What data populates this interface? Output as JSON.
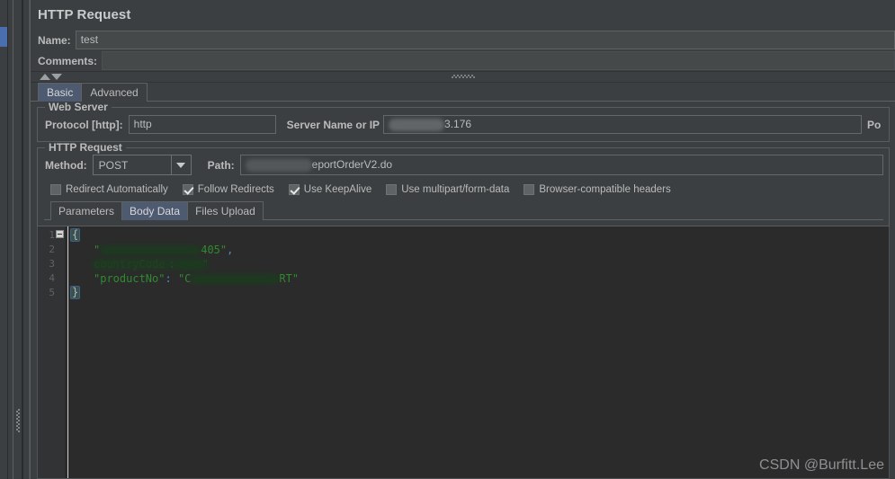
{
  "panel": {
    "title": "HTTP Request",
    "name_label": "Name:",
    "name_value": "test",
    "comments_label": "Comments:",
    "comments_value": ""
  },
  "tabs": [
    {
      "label": "Basic",
      "selected": true
    },
    {
      "label": "Advanced",
      "selected": false
    }
  ],
  "web_server": {
    "group_title": "Web Server",
    "protocol_label": "Protocol [http]:",
    "protocol_value": "http",
    "server_label": "Server Name or IP",
    "server_value": "3.176",
    "port_label": "Po"
  },
  "http_request": {
    "group_title": "HTTP Request",
    "method_label": "Method:",
    "method_value": "POST",
    "path_label": "Path:",
    "path_value": "eportOrderV2.do"
  },
  "options": [
    {
      "label": "Redirect Automatically",
      "checked": false
    },
    {
      "label": "Follow Redirects",
      "checked": true
    },
    {
      "label": "Use KeepAlive",
      "checked": true
    },
    {
      "label": "Use multipart/form-data",
      "checked": false
    },
    {
      "label": "Browser-compatible headers",
      "checked": false
    }
  ],
  "body_tabs": [
    {
      "label": "Parameters",
      "selected": false
    },
    {
      "label": "Body Data",
      "selected": true
    },
    {
      "label": "Files Upload",
      "selected": false
    }
  ],
  "editor": {
    "line_numbers": [
      "1",
      "2",
      "3",
      "4",
      "5"
    ],
    "lines": [
      {
        "open_brace": "{"
      },
      {
        "quote_open": "\"",
        "visible_tail": "405\"",
        "comma": ","
      },
      {
        "quote_open": "\"",
        "key_hint": "countryCode",
        "colon": ":",
        "quote_close": "\""
      },
      {
        "key": "\"productNo\"",
        "colon": ":",
        "value_head": "\"C",
        "value_tail": "RT\""
      },
      {
        "close_brace": "}"
      }
    ]
  },
  "watermark": "CSDN @Burfitt.Lee"
}
